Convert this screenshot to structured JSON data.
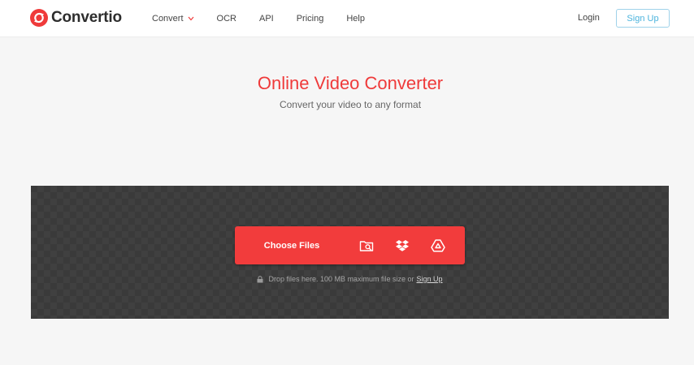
{
  "brand": {
    "name": "Convertio",
    "color": "#ef3a3a"
  },
  "nav": {
    "items": [
      {
        "label": "Convert",
        "has_dropdown": true
      },
      {
        "label": "OCR"
      },
      {
        "label": "API"
      },
      {
        "label": "Pricing"
      },
      {
        "label": "Help"
      }
    ],
    "login_label": "Login",
    "signup_label": "Sign Up"
  },
  "hero": {
    "title": "Online Video Converter",
    "subtitle": "Convert your video to any format"
  },
  "dropzone": {
    "choose_label": "Choose Files",
    "sources": [
      "folder-search-icon",
      "dropbox-icon",
      "google-drive-icon"
    ],
    "note_text": "Drop files here. 100 MB maximum file size or",
    "note_link": "Sign Up"
  }
}
